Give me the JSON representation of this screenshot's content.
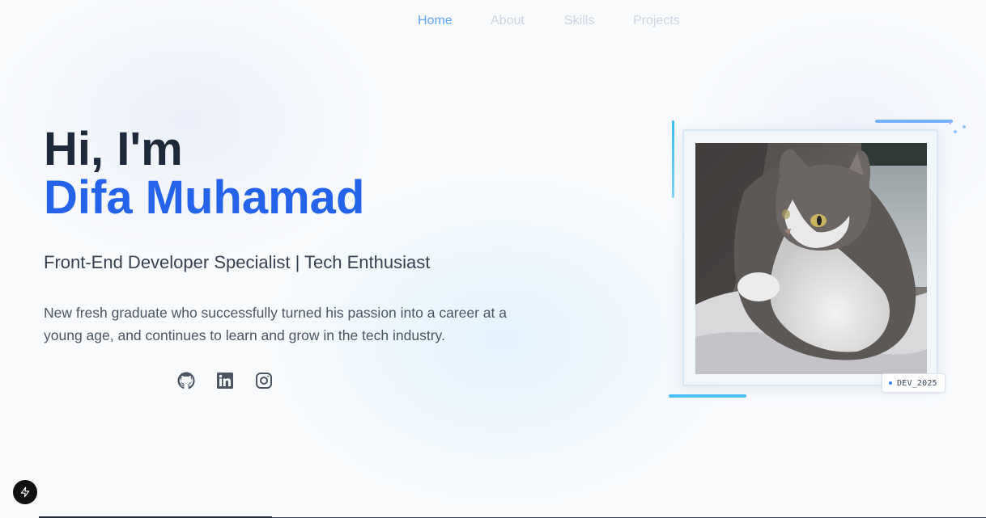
{
  "nav": {
    "items": [
      {
        "label": "Home",
        "active": true
      },
      {
        "label": "About",
        "active": false
      },
      {
        "label": "Skills",
        "active": false
      },
      {
        "label": "Projects",
        "active": false
      }
    ]
  },
  "hero": {
    "greeting": "Hi, I'm",
    "name": "Difa Muhamad",
    "role": "Front-End Developer Specialist | Tech Enthusiast",
    "description": "New fresh graduate who successfully turned his passion into a career at a young age, and continues to learn and grow in the tech industry."
  },
  "socials": [
    {
      "icon": "github-icon"
    },
    {
      "icon": "linkedin-icon"
    },
    {
      "icon": "instagram-icon"
    }
  ],
  "profile": {
    "image": "profile-photo-cat",
    "badge": "DEV_2025"
  },
  "colors": {
    "accent": "#2563eb",
    "nav_active": "#60a5fa",
    "heading": "#1e293b",
    "deco": "#38bdf8"
  }
}
